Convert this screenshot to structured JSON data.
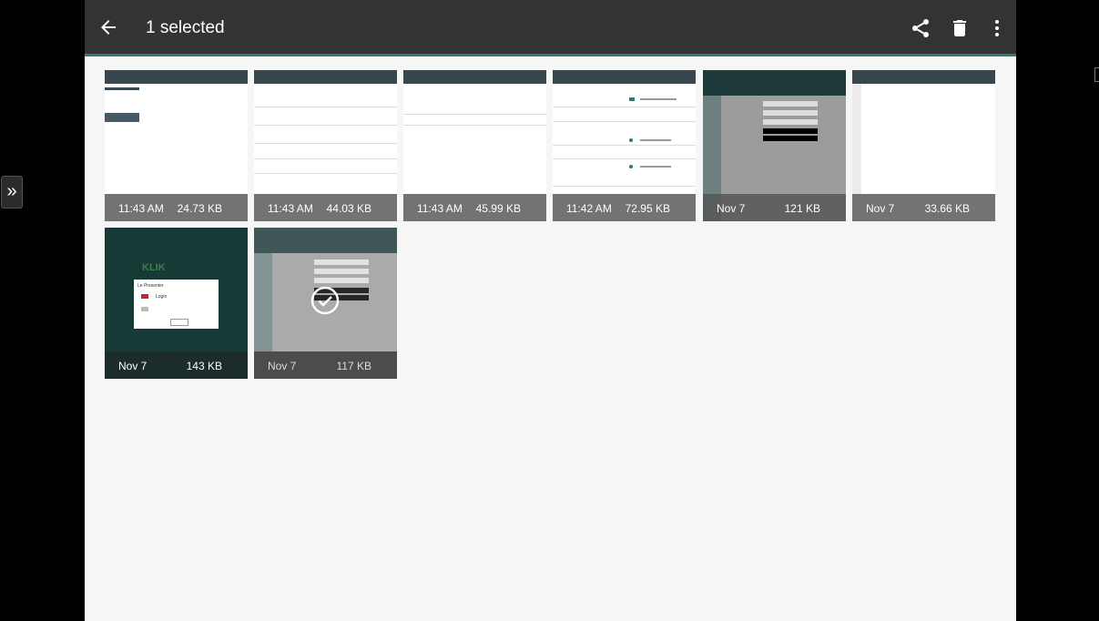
{
  "toolbar": {
    "title": "1 selected",
    "back_icon": "arrow-back-icon",
    "share_icon": "share-icon",
    "delete_icon": "trash-icon",
    "more_icon": "more-vert-icon"
  },
  "side_handle": {
    "glyph": "»"
  },
  "thumbs": [
    {
      "time": "11:43 AM",
      "size": "24.73 KB"
    },
    {
      "time": "11:43 AM",
      "size": "44.03 KB"
    },
    {
      "time": "11:43 AM",
      "size": "45.99 KB"
    },
    {
      "time": "11:42 AM",
      "size": "72.95 KB"
    },
    {
      "time": "Nov 7",
      "size": "121 KB"
    },
    {
      "time": "Nov 7",
      "size": "33.66 KB"
    },
    {
      "time": "Nov 7",
      "size": "143 KB"
    },
    {
      "time": "Nov 7",
      "size": "117 KB"
    }
  ],
  "thumb7": {
    "logo": "KLIK",
    "dialog_title": "Le Presenter",
    "login": "Login"
  },
  "colors": {
    "toolbar": "#333333",
    "accent": "#2a7c74",
    "background": "#f6f6f6",
    "meta_overlay": "#545454"
  },
  "selected_index": 7
}
